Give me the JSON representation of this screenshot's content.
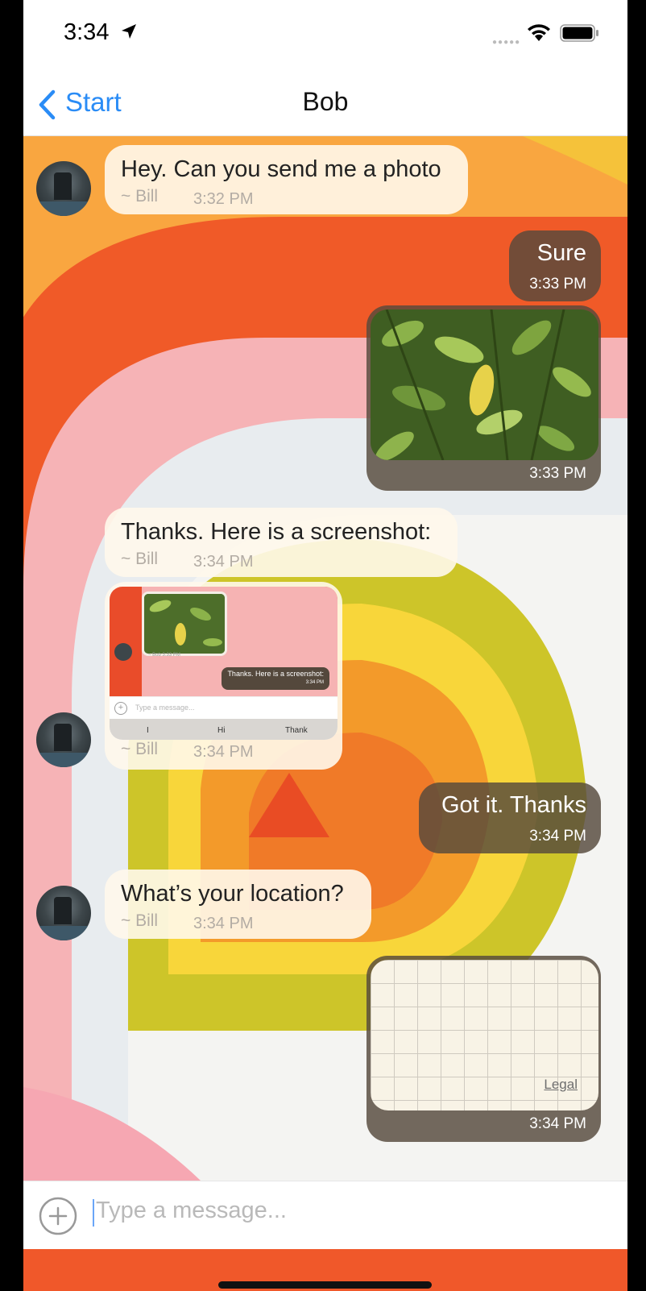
{
  "status_bar": {
    "time": "3:34"
  },
  "nav": {
    "back_label": "Start",
    "title": "Bob"
  },
  "messages": [
    {
      "direction": "incoming",
      "text": "Hey. Can you send me a photo",
      "sender": "~ Bill",
      "time": "3:32 PM"
    },
    {
      "direction": "outgoing",
      "text": "Sure",
      "time": "3:33 PM"
    },
    {
      "direction": "outgoing",
      "type": "photo",
      "time": "3:33 PM"
    },
    {
      "direction": "incoming",
      "text": "Thanks. Here is a screenshot:",
      "sender": "~ Bill",
      "time": "3:34 PM"
    },
    {
      "direction": "incoming",
      "type": "screenshot",
      "sender": "~ Bill",
      "time": "3:34 PM",
      "screenshot": {
        "sender_tag": "~ Bob   3:33 PM",
        "bubble_text": "Thanks. Here is a screenshot:",
        "bubble_time": "3:34 PM",
        "placeholder": "Type a message...",
        "suggestions": [
          "I",
          "Hi",
          "Thank"
        ]
      }
    },
    {
      "direction": "outgoing",
      "text": "Got it. Thanks",
      "time": "3:34 PM"
    },
    {
      "direction": "incoming",
      "text": "What’s your location?",
      "sender": "~ Bill",
      "time": "3:34 PM"
    },
    {
      "direction": "outgoing",
      "type": "location",
      "map_label": "Legal",
      "time": "3:34 PM"
    }
  ],
  "input": {
    "placeholder": "Type a message..."
  },
  "colors": {
    "accent": "#2a8cf6",
    "outgoing_bubble": "#55493c",
    "incoming_bubble": "#fff8eb"
  }
}
